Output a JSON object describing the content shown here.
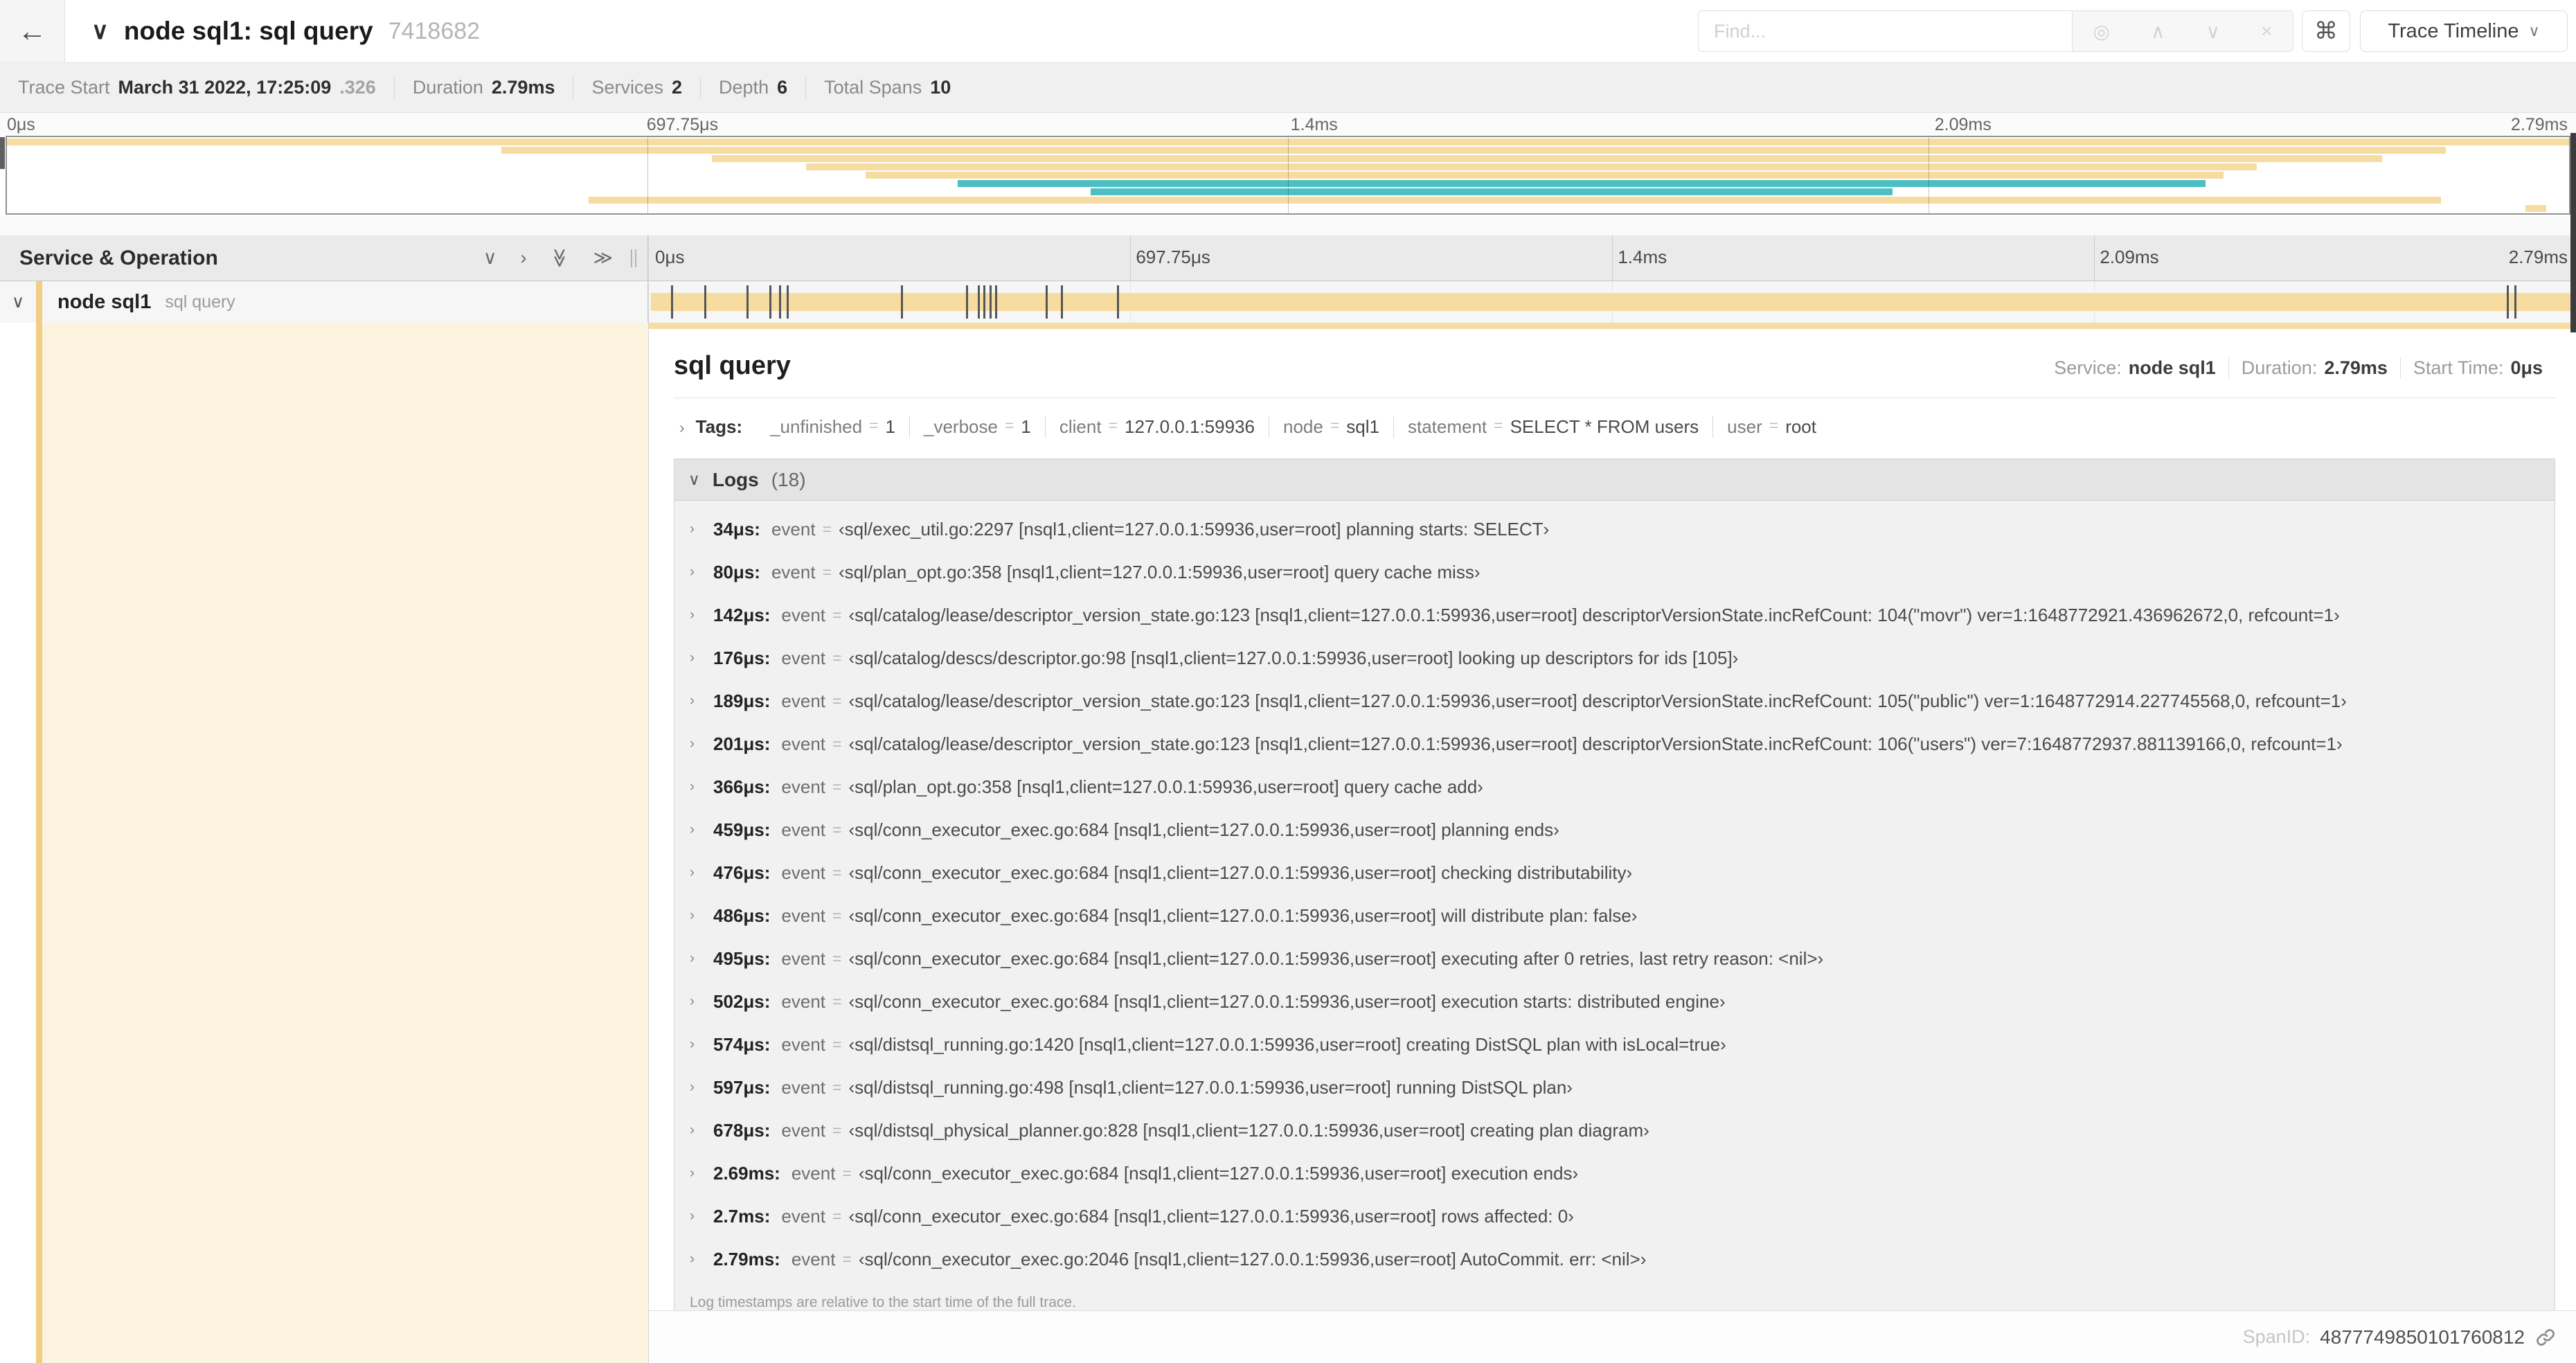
{
  "window": {
    "back_icon": "←",
    "collapse_icon": "∨",
    "title": "node sql1: sql query",
    "trace_id": "7418682"
  },
  "toolbar": {
    "find_placeholder": "Find...",
    "target_icon": "◎",
    "up_icon": "∧",
    "down_icon": "∨",
    "clear_icon": "×",
    "shortcut_key": "⌘",
    "view_button": "Trace Timeline",
    "view_chevron": "∨"
  },
  "summary": {
    "trace_start_label": "Trace Start",
    "trace_start_value": "March 31 2022, 17:25:09",
    "trace_start_frac": ".326",
    "duration_label": "Duration",
    "duration_value": "2.79ms",
    "services_label": "Services",
    "services_value": "2",
    "depth_label": "Depth",
    "depth_value": "6",
    "total_spans_label": "Total Spans",
    "total_spans_value": "10"
  },
  "ruler": {
    "t0": "0μs",
    "t1": "697.75μs",
    "t2": "1.4ms",
    "t3": "2.09ms",
    "t4": "2.79ms"
  },
  "minimap": {
    "colors": {
      "tan": "#f6dca0",
      "teal": "#4bbfc2"
    },
    "bars": [
      {
        "left": 0,
        "width": 100,
        "color": "tan"
      },
      {
        "left": 19.3,
        "width": 75.9,
        "color": "tan"
      },
      {
        "left": 27.5,
        "width": 65.2,
        "color": "tan"
      },
      {
        "left": 31.2,
        "width": 56.6,
        "color": "tan"
      },
      {
        "left": 33.5,
        "width": 53.0,
        "color": "tan"
      },
      {
        "left": 37.1,
        "width": 48.7,
        "color": "teal"
      },
      {
        "left": 42.3,
        "width": 31.3,
        "color": "teal"
      },
      {
        "left": 22.7,
        "width": 72.3,
        "color": "tan"
      },
      {
        "left": 98.3,
        "width": 0.8,
        "color": "tan"
      }
    ]
  },
  "timeline": {
    "header": "Service & Operation",
    "collapse_one_icon": "∨",
    "expand_one_icon": "›",
    "collapse_all_icon": "≫",
    "expand_all_icon": "≫",
    "span": {
      "chevron": "∨",
      "service": "node sql1",
      "operation": "sql query"
    },
    "log_marker_pcts": [
      1.2,
      2.9,
      5.1,
      6.3,
      6.8,
      7.2,
      13.1,
      16.5,
      17.1,
      17.4,
      17.7,
      18.0,
      20.6,
      21.4,
      24.3,
      96.4,
      96.8
    ]
  },
  "detail": {
    "title": "sql query",
    "service_label": "Service:",
    "service_value": "node sql1",
    "duration_label": "Duration:",
    "duration_value": "2.79ms",
    "start_label": "Start Time:",
    "start_value": "0μs",
    "tags_label": "Tags:",
    "tags": [
      {
        "key": "_unfinished",
        "value": "1"
      },
      {
        "key": "_verbose",
        "value": "1"
      },
      {
        "key": "client",
        "value": "127.0.0.1:59936"
      },
      {
        "key": "node",
        "value": "sql1"
      },
      {
        "key": "statement",
        "value": "SELECT * FROM users"
      },
      {
        "key": "user",
        "value": "root"
      }
    ],
    "logs_label": "Logs",
    "logs_count": "(18)",
    "logs": [
      {
        "time": "34μs:",
        "field": "event",
        "value": "‹sql/exec_util.go:2297 [nsql1,client=127.0.0.1:59936,user=root] planning starts: SELECT›"
      },
      {
        "time": "80μs:",
        "field": "event",
        "value": "‹sql/plan_opt.go:358 [nsql1,client=127.0.0.1:59936,user=root] query cache miss›"
      },
      {
        "time": "142μs:",
        "field": "event",
        "value": "‹sql/catalog/lease/descriptor_version_state.go:123 [nsql1,client=127.0.0.1:59936,user=root] descriptorVersionState.incRefCount: 104(\"movr\") ver=1:1648772921.436962672,0, refcount=1›"
      },
      {
        "time": "176μs:",
        "field": "event",
        "value": "‹sql/catalog/descs/descriptor.go:98 [nsql1,client=127.0.0.1:59936,user=root] looking up descriptors for ids [105]›"
      },
      {
        "time": "189μs:",
        "field": "event",
        "value": "‹sql/catalog/lease/descriptor_version_state.go:123 [nsql1,client=127.0.0.1:59936,user=root] descriptorVersionState.incRefCount: 105(\"public\") ver=1:1648772914.227745568,0, refcount=1›"
      },
      {
        "time": "201μs:",
        "field": "event",
        "value": "‹sql/catalog/lease/descriptor_version_state.go:123 [nsql1,client=127.0.0.1:59936,user=root] descriptorVersionState.incRefCount: 106(\"users\") ver=7:1648772937.881139166,0, refcount=1›"
      },
      {
        "time": "366μs:",
        "field": "event",
        "value": "‹sql/plan_opt.go:358 [nsql1,client=127.0.0.1:59936,user=root] query cache add›"
      },
      {
        "time": "459μs:",
        "field": "event",
        "value": "‹sql/conn_executor_exec.go:684 [nsql1,client=127.0.0.1:59936,user=root] planning ends›"
      },
      {
        "time": "476μs:",
        "field": "event",
        "value": "‹sql/conn_executor_exec.go:684 [nsql1,client=127.0.0.1:59936,user=root] checking distributability›"
      },
      {
        "time": "486μs:",
        "field": "event",
        "value": "‹sql/conn_executor_exec.go:684 [nsql1,client=127.0.0.1:59936,user=root] will distribute plan: false›"
      },
      {
        "time": "495μs:",
        "field": "event",
        "value": "‹sql/conn_executor_exec.go:684 [nsql1,client=127.0.0.1:59936,user=root] executing after 0 retries, last retry reason: <nil>›"
      },
      {
        "time": "502μs:",
        "field": "event",
        "value": "‹sql/conn_executor_exec.go:684 [nsql1,client=127.0.0.1:59936,user=root] execution starts: distributed engine›"
      },
      {
        "time": "574μs:",
        "field": "event",
        "value": "‹sql/distsql_running.go:1420 [nsql1,client=127.0.0.1:59936,user=root] creating DistSQL plan with isLocal=true›"
      },
      {
        "time": "597μs:",
        "field": "event",
        "value": "‹sql/distsql_running.go:498 [nsql1,client=127.0.0.1:59936,user=root] running DistSQL plan›"
      },
      {
        "time": "678μs:",
        "field": "event",
        "value": "‹sql/distsql_physical_planner.go:828 [nsql1,client=127.0.0.1:59936,user=root] creating plan diagram›"
      },
      {
        "time": "2.69ms:",
        "field": "event",
        "value": "‹sql/conn_executor_exec.go:684 [nsql1,client=127.0.0.1:59936,user=root] execution ends›"
      },
      {
        "time": "2.7ms:",
        "field": "event",
        "value": "‹sql/conn_executor_exec.go:684 [nsql1,client=127.0.0.1:59936,user=root] rows affected: 0›"
      },
      {
        "time": "2.79ms:",
        "field": "event",
        "value": "‹sql/conn_executor_exec.go:2046 [nsql1,client=127.0.0.1:59936,user=root] AutoCommit. err: <nil>›"
      }
    ],
    "logs_footer": "Log timestamps are relative to the start time of the full trace."
  },
  "footer": {
    "spanid_label": "SpanID:",
    "spanid_value": "4877749850101760812"
  }
}
